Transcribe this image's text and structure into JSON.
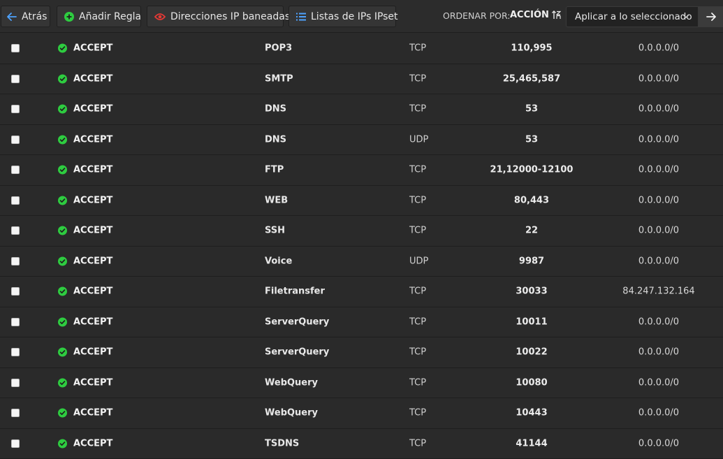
{
  "toolbar": {
    "back_label": "Atrás",
    "add_rule_label": "Añadir Regla",
    "banned_ips_label": "Direcciones IP baneadas",
    "ipset_lists_label": "Listas de IPs IPset",
    "sort_by_label": "ORDENAR POR:",
    "sort_by_value": "ACCIÓN",
    "bulk_action_value": "Aplicar a lo seleccionado"
  },
  "colors": {
    "back_arrow": "#4ea3ff",
    "add_icon": "#2ecc40",
    "banned_icon": "#e53935",
    "ipset_icon": "#4ea3ff",
    "accept_icon": "#2ecc40"
  },
  "rules": [
    {
      "action": "ACCEPT",
      "name": "POP3",
      "protocol": "TCP",
      "port": "110,995",
      "ip": "0.0.0.0/0"
    },
    {
      "action": "ACCEPT",
      "name": "SMTP",
      "protocol": "TCP",
      "port": "25,465,587",
      "ip": "0.0.0.0/0"
    },
    {
      "action": "ACCEPT",
      "name": "DNS",
      "protocol": "TCP",
      "port": "53",
      "ip": "0.0.0.0/0"
    },
    {
      "action": "ACCEPT",
      "name": "DNS",
      "protocol": "UDP",
      "port": "53",
      "ip": "0.0.0.0/0"
    },
    {
      "action": "ACCEPT",
      "name": "FTP",
      "protocol": "TCP",
      "port": "21,12000-12100",
      "ip": "0.0.0.0/0"
    },
    {
      "action": "ACCEPT",
      "name": "WEB",
      "protocol": "TCP",
      "port": "80,443",
      "ip": "0.0.0.0/0"
    },
    {
      "action": "ACCEPT",
      "name": "SSH",
      "protocol": "TCP",
      "port": "22",
      "ip": "0.0.0.0/0"
    },
    {
      "action": "ACCEPT",
      "name": "Voice",
      "protocol": "UDP",
      "port": "9987",
      "ip": "0.0.0.0/0"
    },
    {
      "action": "ACCEPT",
      "name": "Filetransfer",
      "protocol": "TCP",
      "port": "30033",
      "ip": "84.247.132.164"
    },
    {
      "action": "ACCEPT",
      "name": "ServerQuery",
      "protocol": "TCP",
      "port": "10011",
      "ip": "0.0.0.0/0"
    },
    {
      "action": "ACCEPT",
      "name": "ServerQuery",
      "protocol": "TCP",
      "port": "10022",
      "ip": "0.0.0.0/0"
    },
    {
      "action": "ACCEPT",
      "name": "WebQuery",
      "protocol": "TCP",
      "port": "10080",
      "ip": "0.0.0.0/0"
    },
    {
      "action": "ACCEPT",
      "name": "WebQuery",
      "protocol": "TCP",
      "port": "10443",
      "ip": "0.0.0.0/0"
    },
    {
      "action": "ACCEPT",
      "name": "TSDNS",
      "protocol": "TCP",
      "port": "41144",
      "ip": "0.0.0.0/0"
    }
  ]
}
